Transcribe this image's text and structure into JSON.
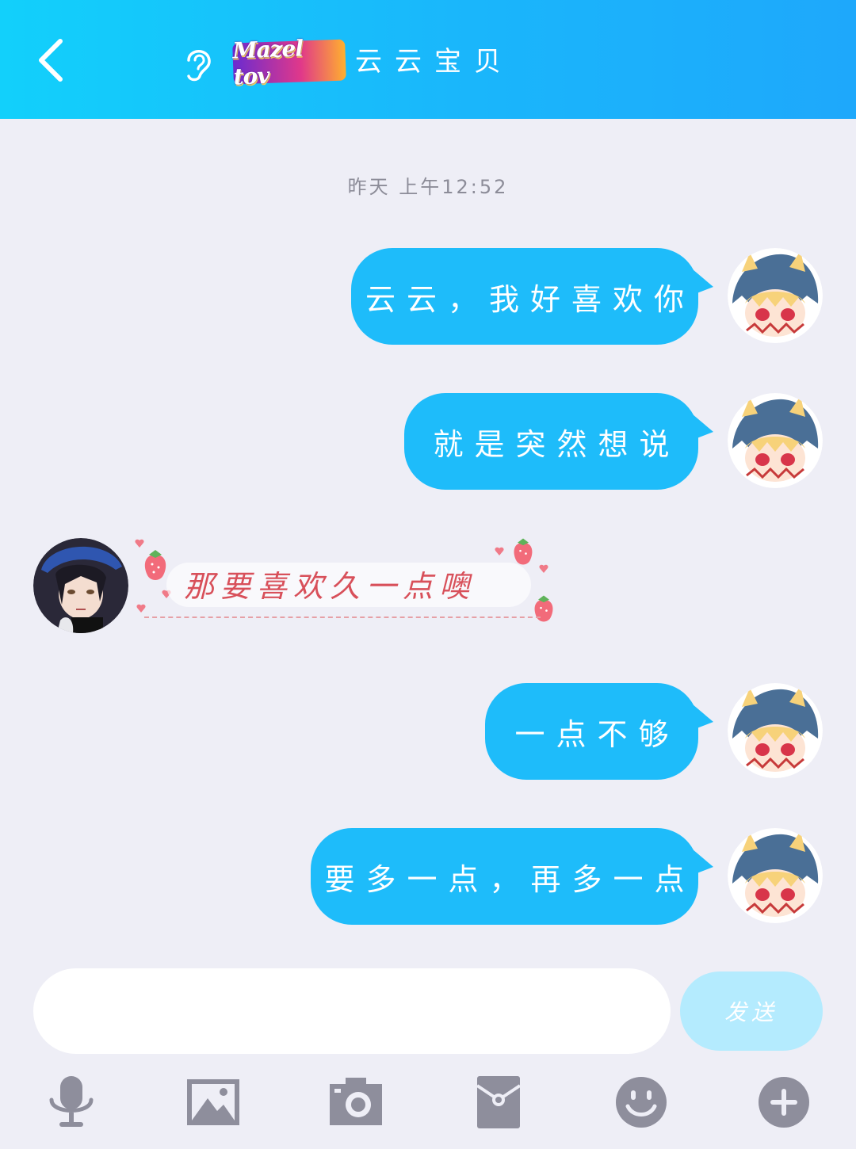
{
  "header": {
    "badge_text": "Mazel tov",
    "title": "云云宝贝",
    "icons": [
      "back-icon",
      "ear-icon"
    ]
  },
  "timestamp": "昨天 上午12:52",
  "messages": [
    {
      "side": "sent",
      "text": "云云，我好喜欢你"
    },
    {
      "side": "sent",
      "text": "就是突然想说"
    },
    {
      "side": "received",
      "text": "那要喜欢久一点噢"
    },
    {
      "side": "sent",
      "text": "一点不够"
    },
    {
      "side": "sent",
      "text": "要多一点，再多一点"
    }
  ],
  "input": {
    "value": "",
    "send_label": "发送"
  },
  "toolbar": {
    "icons": [
      "microphone-icon",
      "image-icon",
      "camera-icon",
      "red-packet-icon",
      "emoji-icon",
      "plus-icon"
    ]
  },
  "colors": {
    "header_gradient_start": "#12d0fb",
    "header_gradient_end": "#1ea8fb",
    "sent_bubble": "#1ebcfa",
    "background": "#eeeef6",
    "received_text": "#d8505a",
    "send_button": "#b4ebfe",
    "toolbar_icon": "#8e8e9c"
  }
}
